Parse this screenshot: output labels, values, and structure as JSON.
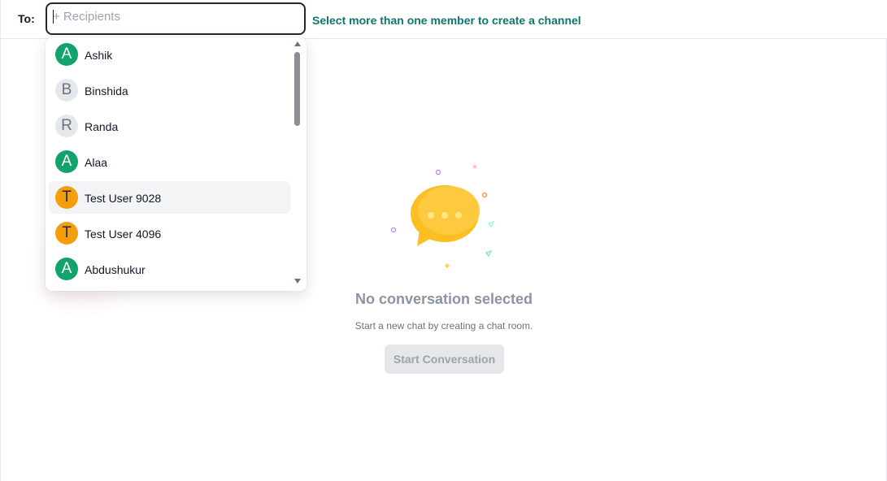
{
  "header": {
    "to_label": "To:",
    "recipients_placeholder": "+ Recipients",
    "recipients_value": "",
    "hint": "Select more than one member to create a channel"
  },
  "dropdown": {
    "options": [
      {
        "initial": "A",
        "name": "Ashik",
        "color": "#11a36b"
      },
      {
        "initial": "B",
        "name": "Binshida",
        "color": "#e5e7eb"
      },
      {
        "initial": "R",
        "name": "Randa",
        "color": "#e5e7eb"
      },
      {
        "initial": "A",
        "name": "Alaa",
        "color": "#11a36b"
      },
      {
        "initial": "T",
        "name": "Test User 9028",
        "color": "#f59e0b"
      },
      {
        "initial": "T",
        "name": "Test User 4096",
        "color": "#f59e0b"
      },
      {
        "initial": "A",
        "name": "Abdushukur",
        "color": "#11a36b"
      }
    ]
  },
  "empty_state": {
    "icon": "chat-bubble-icon",
    "title": "No conversation selected",
    "subtitle": "Start a new chat by creating a chat room.",
    "button_label": "Start Conversation"
  },
  "colors": {
    "accent": "#0f766e",
    "avatar_green": "#11a36b",
    "avatar_orange": "#f59e0b",
    "bubble": "#fbbf24"
  }
}
